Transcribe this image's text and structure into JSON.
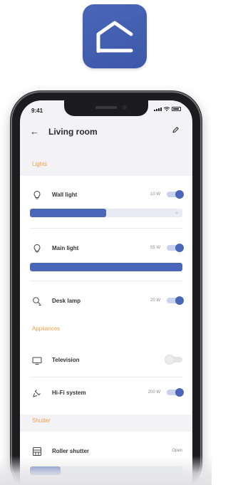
{
  "status_bar": {
    "time": "9:41"
  },
  "header": {
    "title": "Living room",
    "back_symbol": "←"
  },
  "sections": {
    "lights": "Lights",
    "appliances": "Appliances",
    "shutter": "Shutter"
  },
  "devices": {
    "wall_light": {
      "label": "Wall light",
      "value": "10 W",
      "on": true,
      "level": 0.5,
      "icon": "bulb-icon"
    },
    "main_light": {
      "label": "Main light",
      "value": "55 W",
      "on": true,
      "level": 1.0,
      "icon": "bulb-icon"
    },
    "desk_lamp": {
      "label": "Desk lamp",
      "value": "20 W",
      "on": true,
      "icon": "desk-lamp-icon"
    },
    "television": {
      "label": "Television",
      "on": false,
      "icon": "television-icon"
    },
    "hifi": {
      "label": "Hi-Fi system",
      "value": "200 W",
      "on": true,
      "icon": "plug-icon"
    },
    "roller_shutter": {
      "label": "Roller shutter",
      "value": "Open",
      "level": 0.2,
      "icon": "shutter-icon"
    }
  },
  "colors": {
    "accent": "#4a66b8",
    "section_label": "#f0a050",
    "app_icon": "#3f5aab"
  }
}
